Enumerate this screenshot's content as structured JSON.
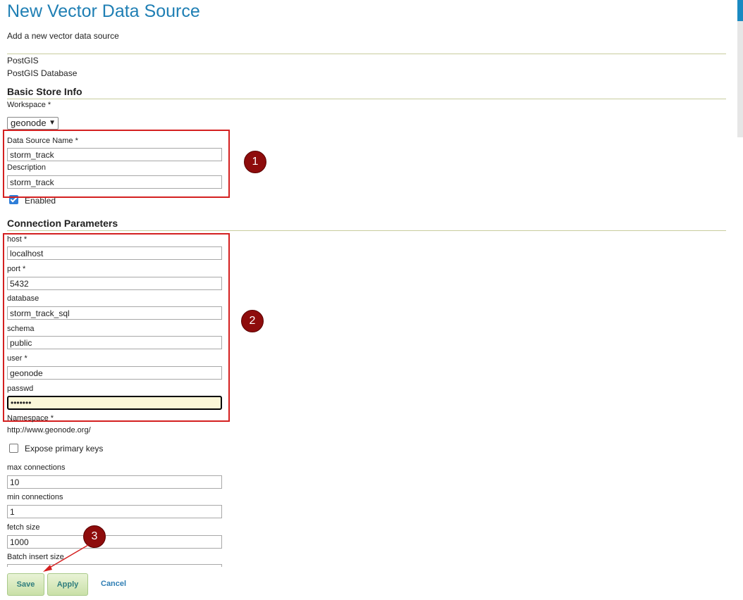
{
  "page": {
    "title": "New Vector Data Source",
    "subtitle": "Add a new vector data source"
  },
  "store_type": {
    "name": "PostGIS",
    "description": "PostGIS Database"
  },
  "basic_info": {
    "heading": "Basic Store Info",
    "workspace_label": "Workspace *",
    "workspace_value": "geonode",
    "name_label": "Data Source Name *",
    "name_value": "storm_track",
    "description_label": "Description",
    "description_value": "storm_track",
    "enabled_label": "Enabled",
    "enabled": true
  },
  "connection": {
    "heading": "Connection Parameters",
    "host_label": "host *",
    "host_value": "localhost",
    "port_label": "port *",
    "port_value": "5432",
    "database_label": "database",
    "database_value": "storm_track_sql",
    "schema_label": "schema",
    "schema_value": "public",
    "user_label": "user *",
    "user_value": "geonode",
    "passwd_label": "passwd",
    "passwd_value": "•••••••",
    "namespace_label": "Namespace *",
    "namespace_value": "http://www.geonode.org/",
    "expose_pk_label": "Expose primary keys",
    "expose_pk": false,
    "max_conn_label": "max connections",
    "max_conn_value": "10",
    "min_conn_label": "min connections",
    "min_conn_value": "1",
    "fetch_size_label": "fetch size",
    "fetch_size_value": "1000",
    "batch_insert_label": "Batch insert size"
  },
  "annotations": {
    "badge1": "1",
    "badge2": "2",
    "badge3": "3",
    "color": "#d42020"
  },
  "actions": {
    "save": "Save",
    "apply": "Apply",
    "cancel": "Cancel"
  }
}
